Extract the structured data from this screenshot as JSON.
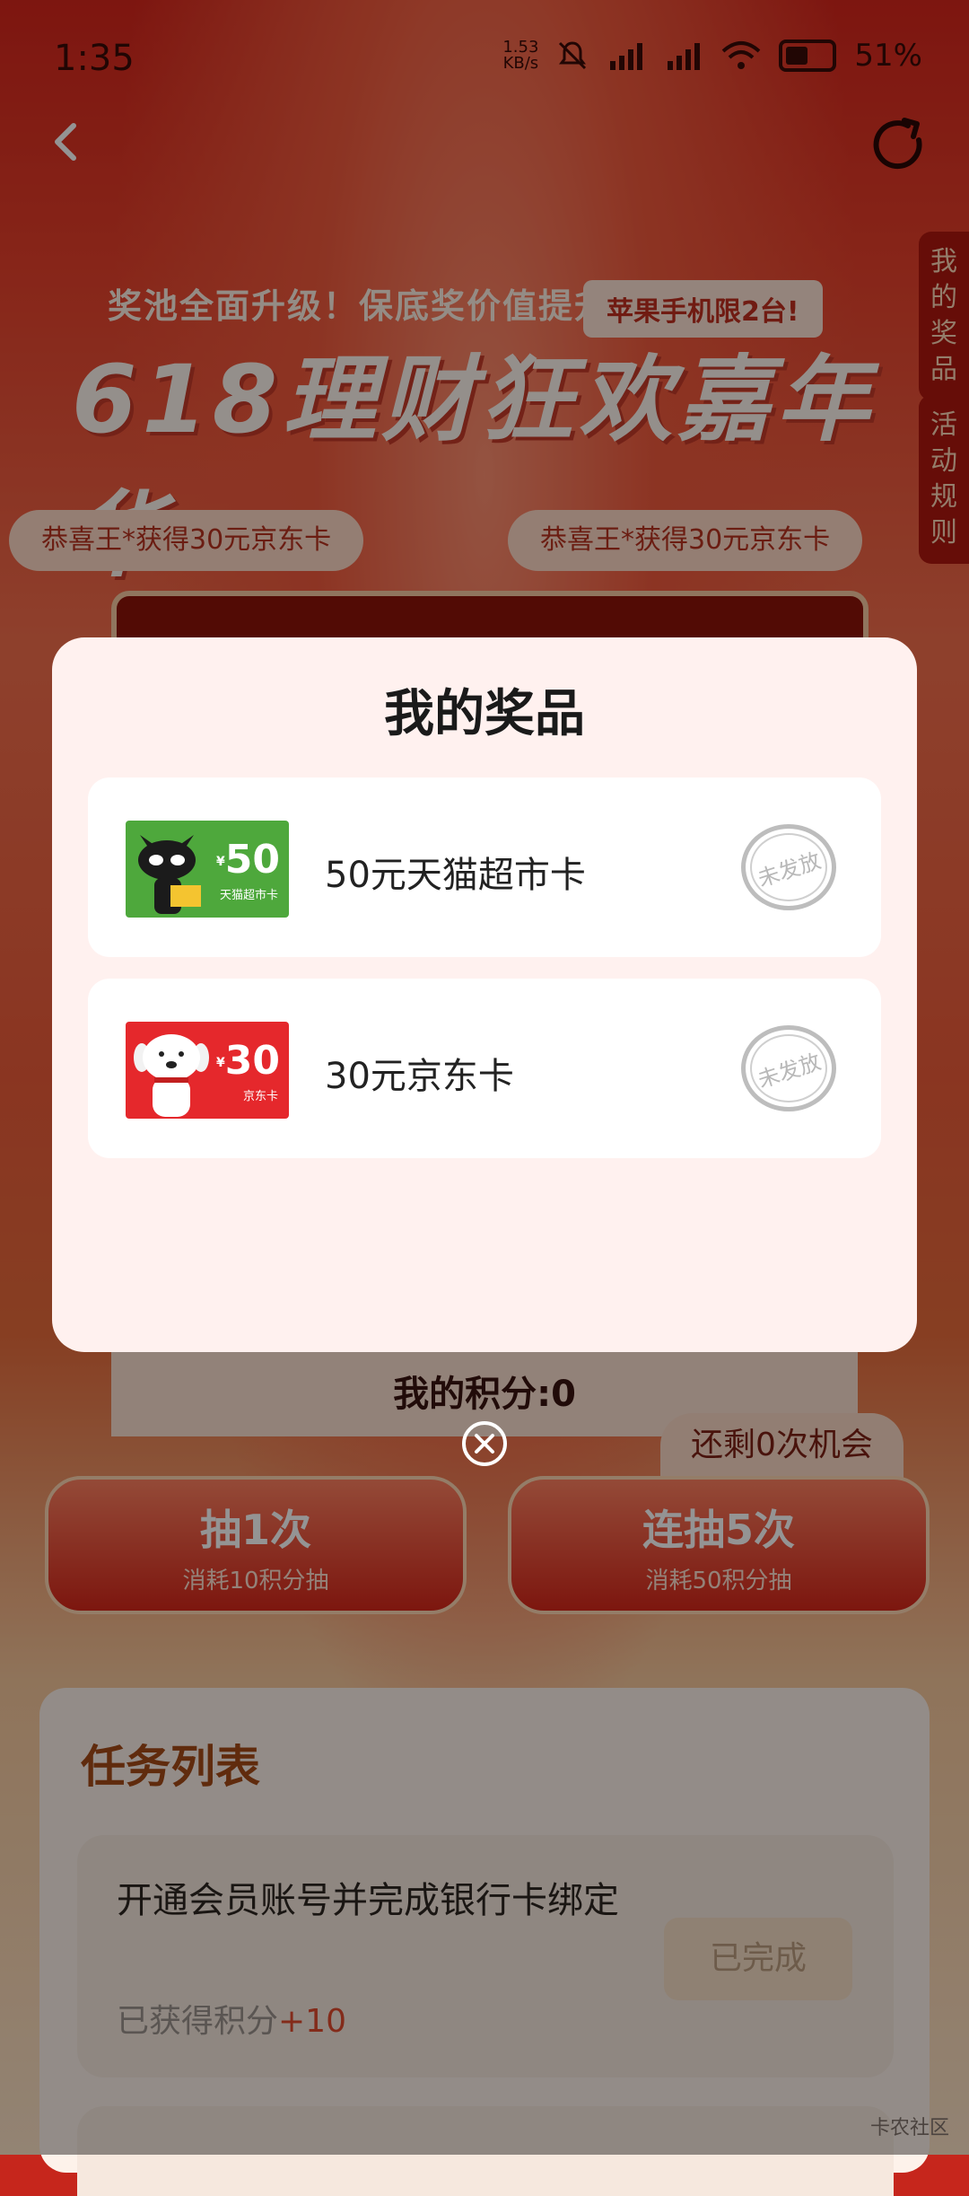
{
  "status_bar": {
    "time": "1:35",
    "net_speed_value": "1.53",
    "net_speed_unit": "KB/s",
    "battery": "51%"
  },
  "nav": {
    "back_icon": "back-arrow-icon",
    "refresh_icon": "refresh-icon"
  },
  "side_tabs": {
    "my_prizes": "我的奖品",
    "rules": "活动规则"
  },
  "banner": {
    "subtitle": "奖池全面升级！保底奖价值提升！",
    "pill": "苹果手机限2台!",
    "title": "618理财狂欢嘉年华"
  },
  "winners": [
    "恭喜王*获得30元京东卡",
    "恭喜王*获得30元京东卡"
  ],
  "points_label": "我的积分:0",
  "chances": "还剩0次机会",
  "draw_buttons": [
    {
      "title": "抽1次",
      "subtitle": "消耗10积分抽"
    },
    {
      "title": "连抽5次",
      "subtitle": "消耗50积分抽"
    }
  ],
  "tasks": {
    "title": "任务列表",
    "items": [
      {
        "text": "开通会员账号并完成银行卡绑定",
        "points_label": "已获得积分",
        "points_value": "+10",
        "button": "已完成"
      }
    ]
  },
  "watermark": "卡农社区",
  "modal": {
    "title": "我的奖品",
    "prizes": [
      {
        "name": "50元天猫超市卡",
        "card_value": "50",
        "card_caption": "天猫超市卡",
        "status": "未发放",
        "card_color": "#4ea83c"
      },
      {
        "name": "30元京东卡",
        "card_value": "30",
        "card_caption": "京东卡",
        "status": "未发放",
        "card_color": "#e5282c"
      }
    ]
  }
}
